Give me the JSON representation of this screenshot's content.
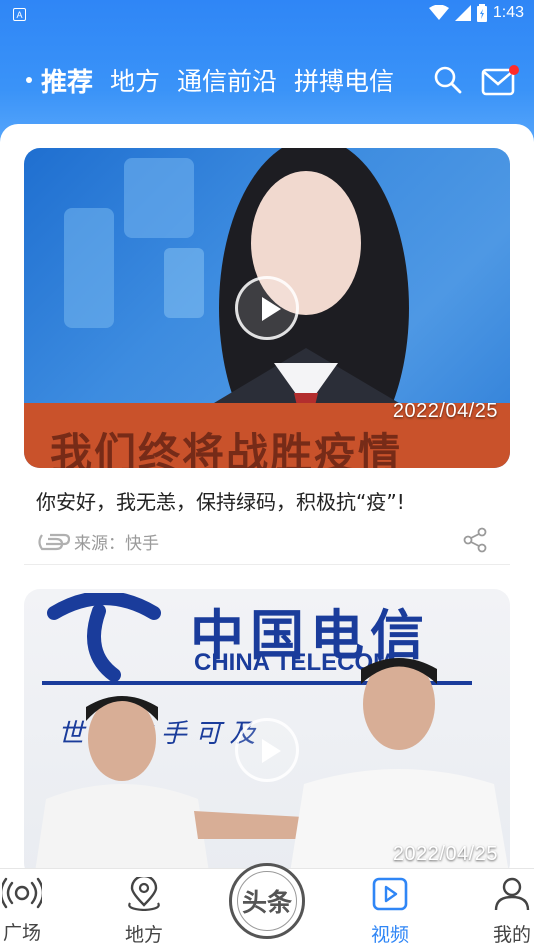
{
  "status_bar": {
    "time": "1:43",
    "app_badge": "A"
  },
  "tabs": [
    {
      "label": "推荐",
      "active": true
    },
    {
      "label": "地方"
    },
    {
      "label": "通信前沿"
    },
    {
      "label": "拼搏电信"
    }
  ],
  "feed": [
    {
      "date": "2022/04/25",
      "caption_overlay": "我们终将战胜疫情",
      "title": "你安好，我无恙，保持绿码，积极抗“疫”!",
      "source": "来源：快手"
    },
    {
      "date": "2022/04/25",
      "logo_text": "中国电信",
      "logo_en": "CHINA TELECOM",
      "slogan": "世 界 触 手 可 及"
    }
  ],
  "bottom_nav": {
    "items": [
      {
        "label": "广场"
      },
      {
        "label": "地方"
      },
      {
        "label": "头条"
      },
      {
        "label": "视频",
        "active": true
      },
      {
        "label": "我的"
      }
    ]
  },
  "colors": {
    "brand_blue": "#2f86f6",
    "notification_red": "#ff2a2a"
  }
}
